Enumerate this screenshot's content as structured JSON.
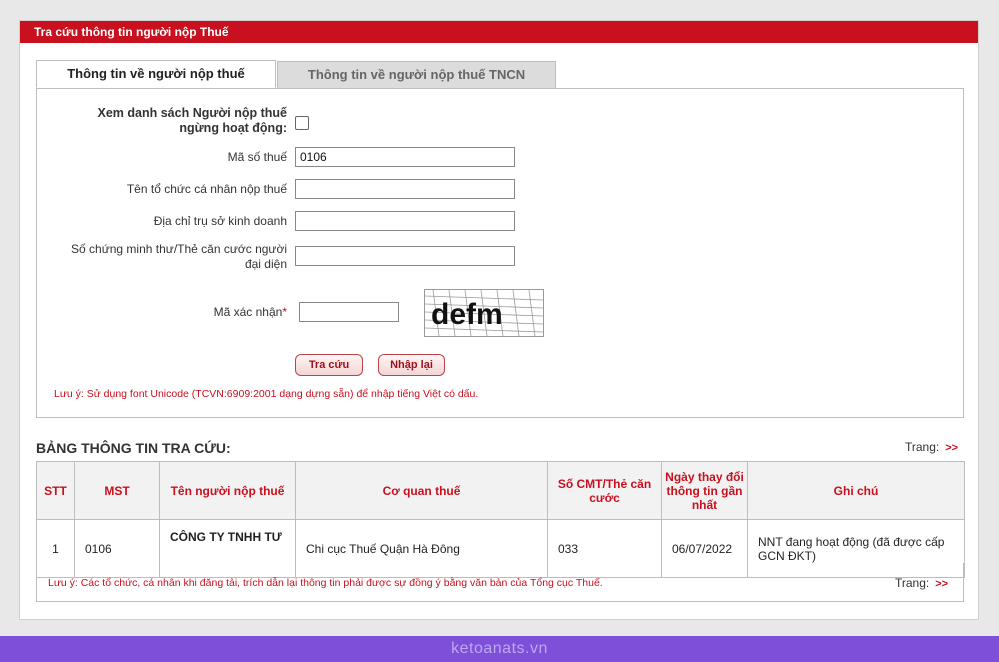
{
  "header": {
    "title": "Tra cứu thông tin người nộp Thuế"
  },
  "tabs": [
    {
      "label": "Thông tin về người nộp thuế"
    },
    {
      "label": "Thông tin về người nộp thuế TNCN"
    }
  ],
  "form": {
    "inactive_label": "Xem danh sách Người nộp thuế ngừng hoạt động:",
    "tax_code_label": "Mã số thuế",
    "tax_code_value": "0106",
    "org_name_label": "Tên tổ chức cá nhân nộp thuế",
    "address_label": "Địa chỉ trụ sở kinh doanh",
    "id_label": "Số chứng minh thư/Thẻ căn cước người đại diện",
    "captcha_label": "Mã xác nhận",
    "captcha_required": "*",
    "captcha_text": "defm",
    "search_button": "Tra cứu",
    "reset_button": "Nhập lại",
    "note": "Lưu ý: Sử dụng font Unicode (TCVN:6909:2001 dạng dựng sẵn) để nhập tiếng Việt có dấu."
  },
  "results": {
    "title": "BẢNG THÔNG TIN TRA CỨU:",
    "page_label": "Trang:",
    "next_label": ">>",
    "columns": [
      "STT",
      "MST",
      "Tên người nộp thuế",
      "Cơ quan thuế",
      "Số CMT/Thẻ căn cước",
      "Ngày thay đổi thông tin gần nhất",
      "Ghi chú"
    ],
    "rows": [
      [
        "1",
        "0106",
        "CÔNG TY TNHH TƯ",
        "Chi cục Thuế Quận Hà Đông",
        "033",
        "06/07/2022",
        "NNT đang hoạt động (đã được cấp GCN ĐKT)"
      ]
    ],
    "note": "Lưu ý: Các tổ chức, cá nhân khi đăng tải, trích dẫn lại thông tin phải được sự đồng ý bằng văn bản của Tổng cục Thuế."
  },
  "watermark": "ketoanats.vn",
  "colors": {
    "accent": "#C8101E",
    "background": "#7E4FD8"
  }
}
